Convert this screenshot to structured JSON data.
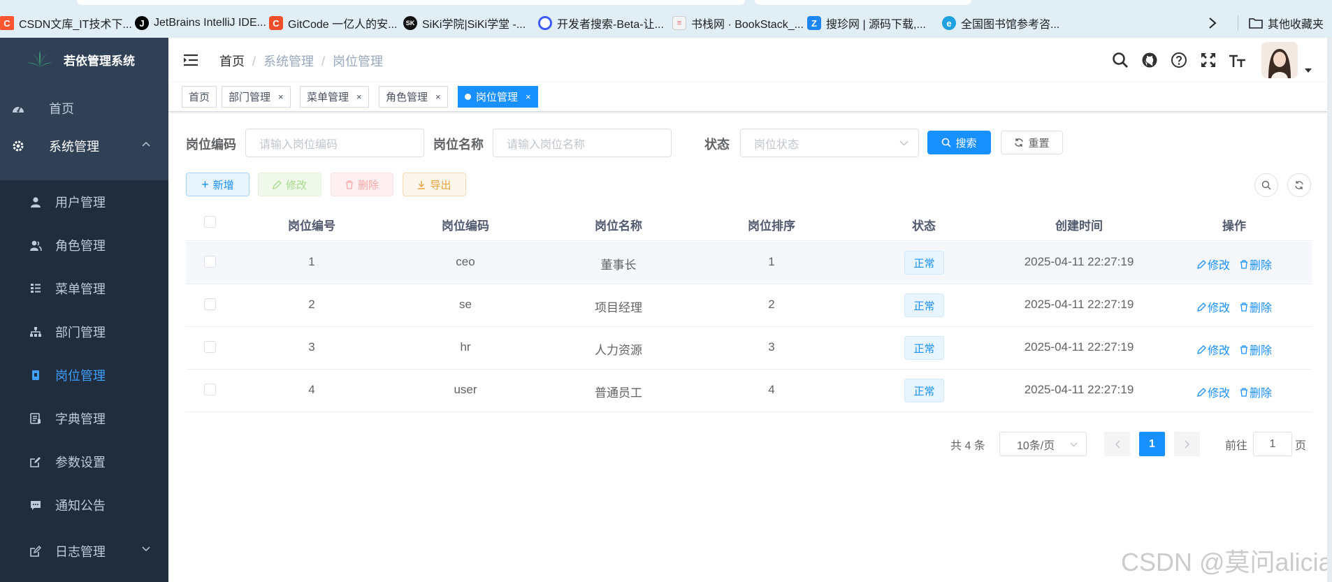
{
  "bookmarks": [
    {
      "label": "CSDN文库_IT技术下...",
      "icon": "csdn-icon",
      "color": "#fc5531"
    },
    {
      "label": "JetBrains IntelliJ IDE...",
      "icon": "jetbrains-icon",
      "color": "#000000"
    },
    {
      "label": "GitCode 一亿人的安...",
      "icon": "gitcode-icon",
      "color": "#f04d29"
    },
    {
      "label": "SiKi学院|SiKi学堂 -...",
      "icon": "siki-icon",
      "color": "#111111"
    },
    {
      "label": "开发者搜索-Beta-让...",
      "icon": "devsearch-icon",
      "color": "#3b5bff"
    },
    {
      "label": "书栈网 · BookStack_...",
      "icon": "bookstack-icon",
      "color": "#e86a6a"
    },
    {
      "label": "搜珍网 | 源码下载,...",
      "icon": "souzhen-icon",
      "color": "#1d86f0"
    },
    {
      "label": "全国图书馆参考咨...",
      "icon": "ie-icon",
      "color": "#1fa0e0"
    }
  ],
  "bookmarks_folder": "其他收藏夹",
  "app": {
    "title": "若依管理系统"
  },
  "sidebar": {
    "home": "首页",
    "system": "系统管理",
    "items": [
      {
        "label": "用户管理",
        "icon": "user-icon"
      },
      {
        "label": "角色管理",
        "icon": "peoples-icon"
      },
      {
        "label": "菜单管理",
        "icon": "tree-table-icon"
      },
      {
        "label": "部门管理",
        "icon": "tree-icon"
      },
      {
        "label": "岗位管理",
        "icon": "post-icon"
      },
      {
        "label": "字典管理",
        "icon": "dict-icon"
      },
      {
        "label": "参数设置",
        "icon": "edit-icon"
      },
      {
        "label": "通知公告",
        "icon": "message-icon"
      }
    ],
    "log": "日志管理"
  },
  "breadcrumb": [
    "首页",
    "系统管理",
    "岗位管理"
  ],
  "tags": [
    "首页",
    "部门管理",
    "菜单管理",
    "角色管理",
    "岗位管理"
  ],
  "search": {
    "code_label": "岗位编码",
    "code_placeholder": "请输入岗位编码",
    "name_label": "岗位名称",
    "name_placeholder": "请输入岗位名称",
    "status_label": "状态",
    "status_placeholder": "岗位状态",
    "search_btn": "搜索",
    "reset_btn": "重置"
  },
  "toolbar": {
    "add": "新增",
    "edit": "修改",
    "delete": "删除",
    "export": "导出"
  },
  "table": {
    "headers": [
      "岗位编号",
      "岗位编码",
      "岗位名称",
      "岗位排序",
      "状态",
      "创建时间",
      "操作"
    ],
    "rows": [
      {
        "id": "1",
        "code": "ceo",
        "name": "董事长",
        "sort": "1",
        "status": "正常",
        "time": "2025-04-11 22:27:19"
      },
      {
        "id": "2",
        "code": "se",
        "name": "项目经理",
        "sort": "2",
        "status": "正常",
        "time": "2025-04-11 22:27:19"
      },
      {
        "id": "3",
        "code": "hr",
        "name": "人力资源",
        "sort": "3",
        "status": "正常",
        "time": "2025-04-11 22:27:19"
      },
      {
        "id": "4",
        "code": "user",
        "name": "普通员工",
        "sort": "4",
        "status": "正常",
        "time": "2025-04-11 22:27:19"
      }
    ],
    "op_edit": "修改",
    "op_delete": "删除"
  },
  "pagination": {
    "total": "共 4 条",
    "page_size": "10条/页",
    "current": "1",
    "goto_label": "前往",
    "goto_value": "1",
    "page_unit": "页"
  },
  "watermark": "CSDN @莫问alicia",
  "colors": {
    "primary": "#1890ff",
    "sidebar": "#304156",
    "submenu": "#1f2d3d"
  }
}
